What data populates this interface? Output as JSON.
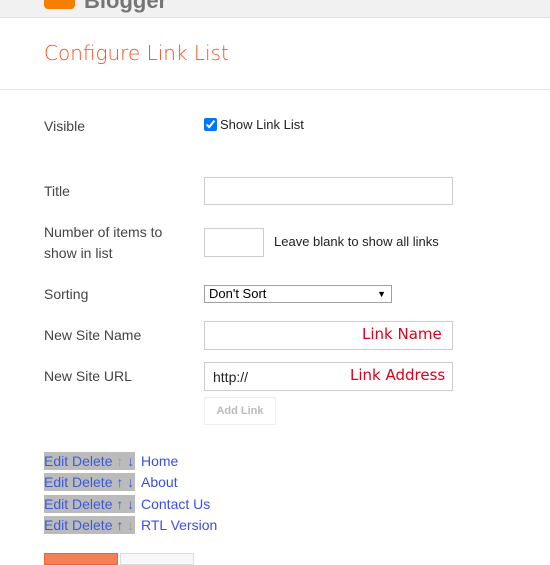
{
  "header": {
    "logo_text": "Blogger",
    "title": "Configure Link List"
  },
  "form": {
    "visible_label": "Visible",
    "visible_checkbox_label": "Show Link List",
    "visible_checked": true,
    "title_label": "Title",
    "title_value": "",
    "items_label_line1": "Number of items to",
    "items_label_line2": "show in list",
    "items_value": "",
    "items_hint": "Leave blank to show all links",
    "sorting_label": "Sorting",
    "sorting_value": "Don't Sort",
    "site_name_label": "New Site Name",
    "site_name_value": "",
    "site_name_annotation": "Link Name",
    "site_url_label": "New Site URL",
    "site_url_value": "http://",
    "site_url_annotation": "Link Address",
    "add_link": "Add Link"
  },
  "links": {
    "edit": "Edit",
    "delete": "Delete",
    "up": "↑",
    "down": "↓",
    "items": [
      {
        "name": "Home"
      },
      {
        "name": "About"
      },
      {
        "name": "Contact Us"
      },
      {
        "name": "RTL Version"
      }
    ]
  }
}
